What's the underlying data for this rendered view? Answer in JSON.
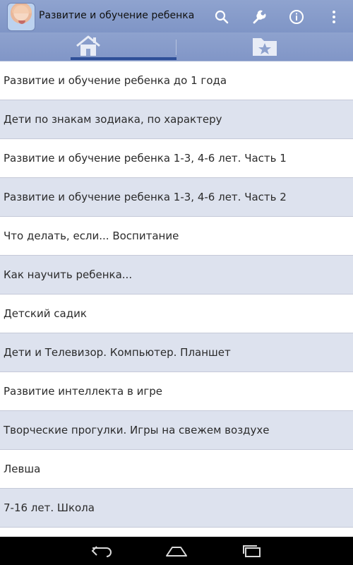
{
  "app": {
    "title": "Развитие и обучение ребенка",
    "icon": "baby-photo-icon"
  },
  "actionbar": {
    "actions": [
      "search-icon",
      "wrench-icon",
      "info-icon",
      "overflow-menu-icon"
    ]
  },
  "tabs": {
    "items": [
      "home-icon",
      "favorites-folder-icon"
    ],
    "selected_index": 0
  },
  "list": {
    "items": [
      "Развитие и обучение ребенка до 1 года",
      "Дети по знакам зодиака, по характеру",
      "Развитие и обучение ребенка 1-3, 4-6 лет. Часть 1",
      "Развитие и обучение ребенка 1-3, 4-6 лет. Часть 2",
      "Что делать, если... Воспитание",
      "Как научить ребенка...",
      "Детский садик",
      "Дети и Телевизор. Компьютер. Планшет",
      "Развитие интеллекта в игре",
      "Творческие прогулки. Игры на свежем воздухе",
      "Левша",
      "7-16 лет. Школа"
    ]
  },
  "navbar": {
    "buttons": [
      "back-icon",
      "home-nav-icon",
      "recent-apps-icon"
    ]
  },
  "colors": {
    "actionbar": "#8a9ecc",
    "tab_indicator": "#2f4f98",
    "row_alt": "#dde2ee",
    "row_divider": "#c5c9d8",
    "navbar": "#000000"
  }
}
